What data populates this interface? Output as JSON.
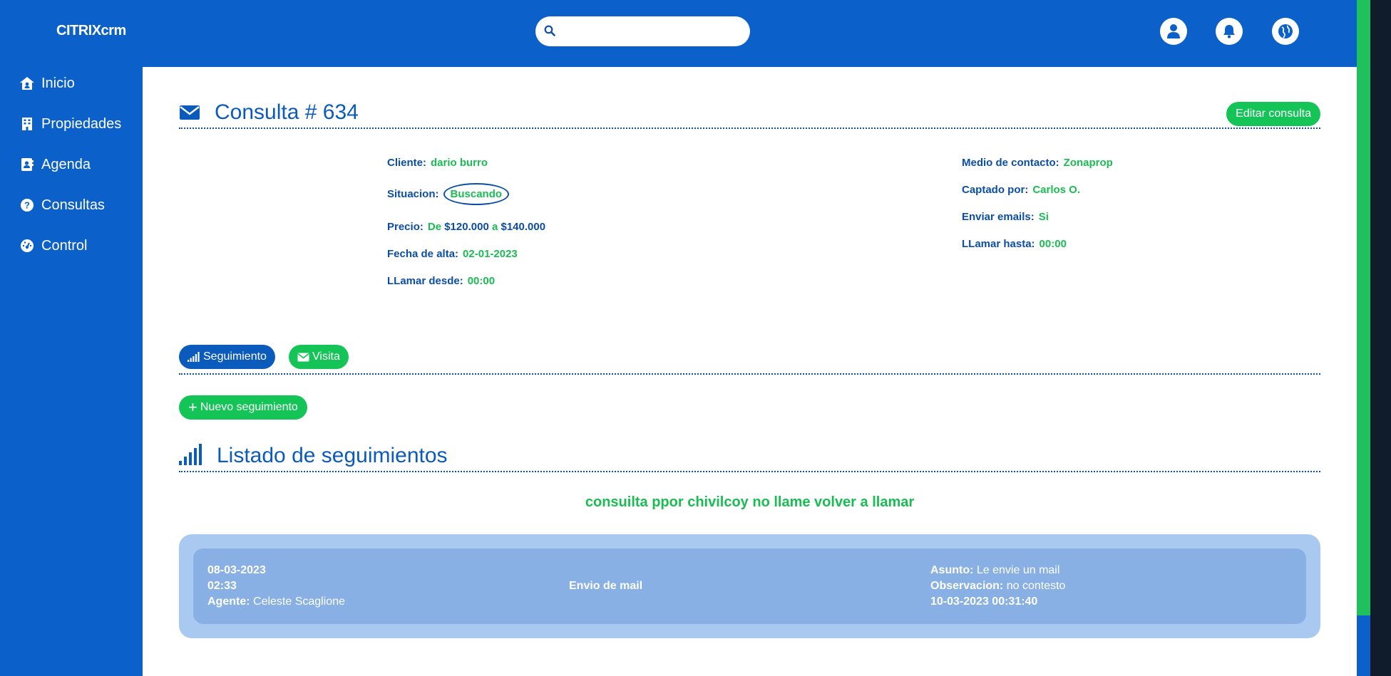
{
  "app": {
    "brand": "CITRIXcrm"
  },
  "search": {
    "placeholder": ""
  },
  "top_icons": [
    "user-icon",
    "bell-icon",
    "globe-icon"
  ],
  "sidebar": {
    "items": [
      {
        "label": "Inicio",
        "icon": "home-icon"
      },
      {
        "label": "Propiedades",
        "icon": "building-icon"
      },
      {
        "label": "Agenda",
        "icon": "address-book-icon"
      },
      {
        "label": "Consultas",
        "icon": "question-circle-icon"
      },
      {
        "label": "Control",
        "icon": "dashboard-icon"
      }
    ]
  },
  "consulta": {
    "title": "Consulta # 634",
    "edit_label": "Editar consulta",
    "cliente_label": "Cliente:",
    "cliente": "dario burro",
    "situacion_label": "Situacion:",
    "situacion": "Buscando",
    "precio_label": "Precio:",
    "precio_de": "De",
    "precio_min": "$120.000",
    "precio_a": "a",
    "precio_max": "$140.000",
    "fecha_label": "Fecha de alta:",
    "fecha": "02-01-2023",
    "llamar_desde_label": "LLamar desde:",
    "llamar_desde": "00:00",
    "medio_label": "Medio de contacto:",
    "medio": "Zonaprop",
    "captado_label": "Captado por:",
    "captado": "Carlos O.",
    "emails_label": "Enviar emails:",
    "emails": "Si",
    "llamar_hasta_label": "LLamar hasta:",
    "llamar_hasta": "00:00"
  },
  "tabs": {
    "seguimiento": "Seguimiento",
    "visita": "Visita"
  },
  "nuevo_label": "Nuevo seguimiento",
  "listado": {
    "title": "Listado de seguimientos",
    "note": "consuilta ppor chivilcoy no llame volver a llamar",
    "items": [
      {
        "date": "08-03-2023",
        "time": "02:33",
        "agente_label": "Agente:",
        "agente": "Celeste Scaglione",
        "type": "Envio de mail",
        "asunto_label": "Asunto:",
        "asunto": "Le envie un mail",
        "observacion_label": "Observacion:",
        "observacion": "no contesto",
        "timestamp": "10-03-2023 00:31:40"
      }
    ]
  },
  "colors": {
    "primary": "#0b60c9",
    "accent_green": "#14c457",
    "card_bg": "#88b0e4"
  }
}
